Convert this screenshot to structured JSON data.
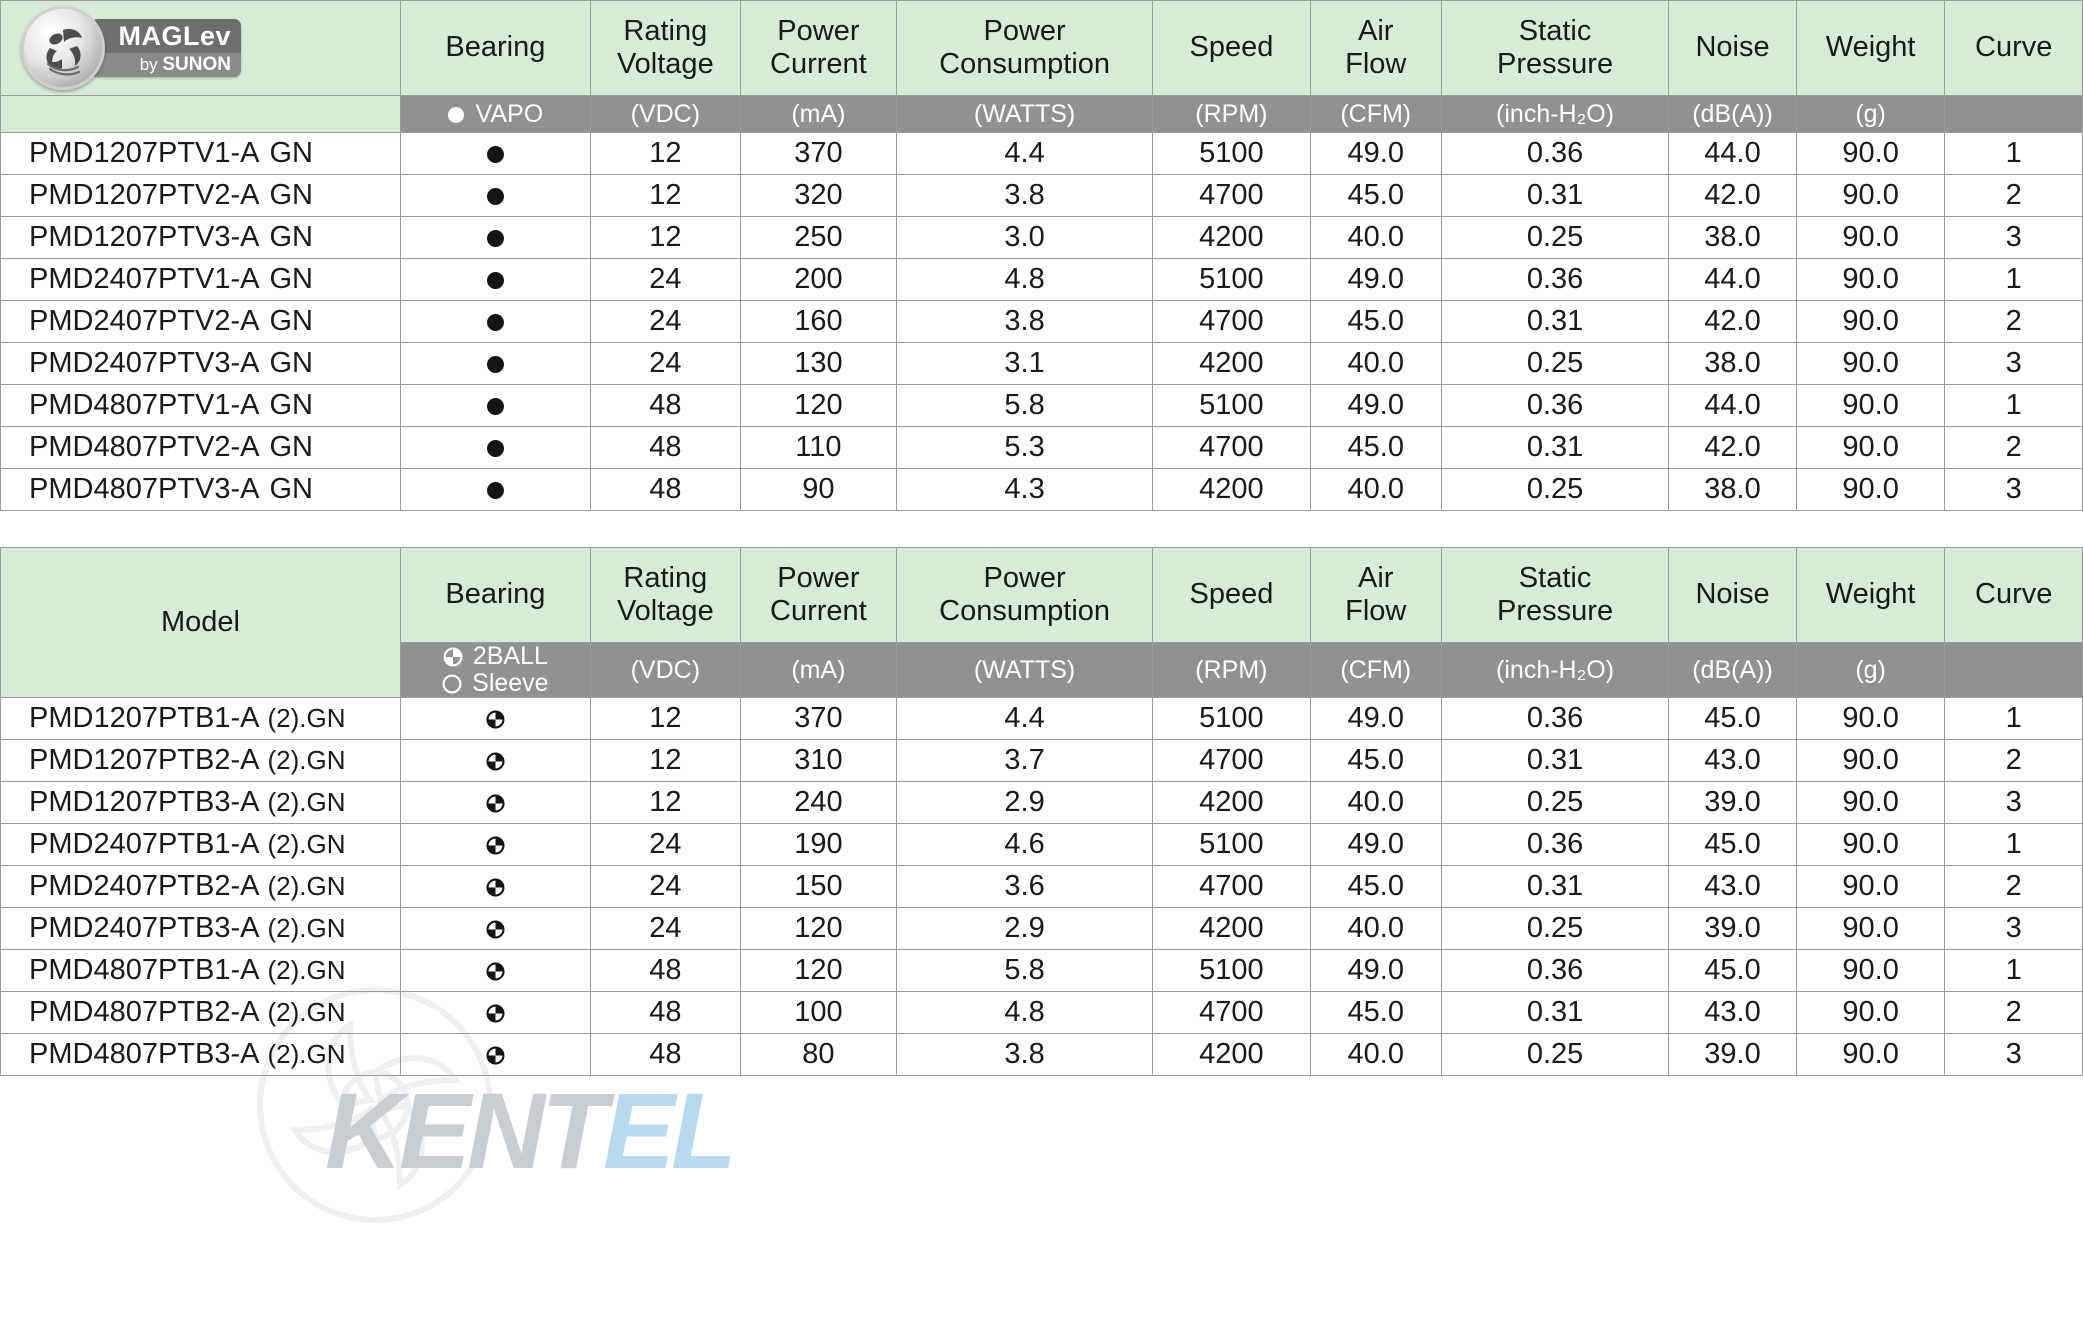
{
  "logo": {
    "brand": "MAGLev",
    "byline_prefix": "by ",
    "byline_brand": "SUNON",
    "icon": "maglev-fan-logo"
  },
  "watermark": {
    "text_part1": "KENT",
    "text_part2": "EL",
    "icon": "fan-blade-icon"
  },
  "columns": {
    "model": "Model",
    "bearing": "Bearing",
    "rating_voltage_l1": "Rating",
    "rating_voltage_l2": "Voltage",
    "power_current_l1": "Power",
    "power_current_l2": "Current",
    "power_consumption_l1": "Power",
    "power_consumption_l2": "Consumption",
    "speed": "Speed",
    "air_flow_l1": "Air",
    "air_flow_l2": "Flow",
    "static_pressure_l1": "Static",
    "static_pressure_l2": "Pressure",
    "noise": "Noise",
    "weight": "Weight",
    "curve": "Curve"
  },
  "units": {
    "bearing_vapo": "VAPO",
    "bearing_2ball": "2BALL",
    "bearing_sleeve": "Sleeve",
    "rating_voltage": "(VDC)",
    "power_current": "(mA)",
    "power_consumption": "(WATTS)",
    "speed": "(RPM)",
    "air_flow": "(CFM)",
    "static_pressure": "(inch-H₂O)",
    "noise": "(dB(A))",
    "weight": "(g)",
    "curve": ""
  },
  "table1": {
    "bearing_type": "vapo",
    "rows": [
      {
        "model": "PMD1207PTV1-A",
        "suffix": "GN",
        "voltage": "12",
        "current": "370",
        "consumption": "4.4",
        "speed": "5100",
        "airflow": "49.0",
        "pressure": "0.36",
        "noise": "44.0",
        "weight": "90.0",
        "curve": "1"
      },
      {
        "model": "PMD1207PTV2-A",
        "suffix": "GN",
        "voltage": "12",
        "current": "320",
        "consumption": "3.8",
        "speed": "4700",
        "airflow": "45.0",
        "pressure": "0.31",
        "noise": "42.0",
        "weight": "90.0",
        "curve": "2"
      },
      {
        "model": "PMD1207PTV3-A",
        "suffix": "GN",
        "voltage": "12",
        "current": "250",
        "consumption": "3.0",
        "speed": "4200",
        "airflow": "40.0",
        "pressure": "0.25",
        "noise": "38.0",
        "weight": "90.0",
        "curve": "3"
      },
      {
        "model": "PMD2407PTV1-A",
        "suffix": "GN",
        "voltage": "24",
        "current": "200",
        "consumption": "4.8",
        "speed": "5100",
        "airflow": "49.0",
        "pressure": "0.36",
        "noise": "44.0",
        "weight": "90.0",
        "curve": "1"
      },
      {
        "model": "PMD2407PTV2-A",
        "suffix": "GN",
        "voltage": "24",
        "current": "160",
        "consumption": "3.8",
        "speed": "4700",
        "airflow": "45.0",
        "pressure": "0.31",
        "noise": "42.0",
        "weight": "90.0",
        "curve": "2"
      },
      {
        "model": "PMD2407PTV3-A",
        "suffix": "GN",
        "voltage": "24",
        "current": "130",
        "consumption": "3.1",
        "speed": "4200",
        "airflow": "40.0",
        "pressure": "0.25",
        "noise": "38.0",
        "weight": "90.0",
        "curve": "3"
      },
      {
        "model": "PMD4807PTV1-A",
        "suffix": "GN",
        "voltage": "48",
        "current": "120",
        "consumption": "5.8",
        "speed": "5100",
        "airflow": "49.0",
        "pressure": "0.36",
        "noise": "44.0",
        "weight": "90.0",
        "curve": "1"
      },
      {
        "model": "PMD4807PTV2-A",
        "suffix": "GN",
        "voltage": "48",
        "current": "110",
        "consumption": "5.3",
        "speed": "4700",
        "airflow": "45.0",
        "pressure": "0.31",
        "noise": "42.0",
        "weight": "90.0",
        "curve": "2"
      },
      {
        "model": "PMD4807PTV3-A",
        "suffix": "GN",
        "voltage": "48",
        "current": "90",
        "consumption": "4.3",
        "speed": "4200",
        "airflow": "40.0",
        "pressure": "0.25",
        "noise": "38.0",
        "weight": "90.0",
        "curve": "3"
      }
    ]
  },
  "table2": {
    "bearing_type": "2ball",
    "rows": [
      {
        "model": "PMD1207PTB1-A",
        "suffix": "(2).GN",
        "voltage": "12",
        "current": "370",
        "consumption": "4.4",
        "speed": "5100",
        "airflow": "49.0",
        "pressure": "0.36",
        "noise": "45.0",
        "weight": "90.0",
        "curve": "1"
      },
      {
        "model": "PMD1207PTB2-A",
        "suffix": "(2).GN",
        "voltage": "12",
        "current": "310",
        "consumption": "3.7",
        "speed": "4700",
        "airflow": "45.0",
        "pressure": "0.31",
        "noise": "43.0",
        "weight": "90.0",
        "curve": "2"
      },
      {
        "model": "PMD1207PTB3-A",
        "suffix": "(2).GN",
        "voltage": "12",
        "current": "240",
        "consumption": "2.9",
        "speed": "4200",
        "airflow": "40.0",
        "pressure": "0.25",
        "noise": "39.0",
        "weight": "90.0",
        "curve": "3"
      },
      {
        "model": "PMD2407PTB1-A",
        "suffix": "(2).GN",
        "voltage": "24",
        "current": "190",
        "consumption": "4.6",
        "speed": "5100",
        "airflow": "49.0",
        "pressure": "0.36",
        "noise": "45.0",
        "weight": "90.0",
        "curve": "1"
      },
      {
        "model": "PMD2407PTB2-A",
        "suffix": "(2).GN",
        "voltage": "24",
        "current": "150",
        "consumption": "3.6",
        "speed": "4700",
        "airflow": "45.0",
        "pressure": "0.31",
        "noise": "43.0",
        "weight": "90.0",
        "curve": "2"
      },
      {
        "model": "PMD2407PTB3-A",
        "suffix": "(2).GN",
        "voltage": "24",
        "current": "120",
        "consumption": "2.9",
        "speed": "4200",
        "airflow": "40.0",
        "pressure": "0.25",
        "noise": "39.0",
        "weight": "90.0",
        "curve": "3"
      },
      {
        "model": "PMD4807PTB1-A",
        "suffix": "(2).GN",
        "voltage": "48",
        "current": "120",
        "consumption": "5.8",
        "speed": "5100",
        "airflow": "49.0",
        "pressure": "0.36",
        "noise": "45.0",
        "weight": "90.0",
        "curve": "1"
      },
      {
        "model": "PMD4807PTB2-A",
        "suffix": "(2).GN",
        "voltage": "48",
        "current": "100",
        "consumption": "4.8",
        "speed": "4700",
        "airflow": "45.0",
        "pressure": "0.31",
        "noise": "43.0",
        "weight": "90.0",
        "curve": "2"
      },
      {
        "model": "PMD4807PTB3-A",
        "suffix": "(2).GN",
        "voltage": "48",
        "current": "80",
        "consumption": "3.8",
        "speed": "4200",
        "airflow": "40.0",
        "pressure": "0.25",
        "noise": "39.0",
        "weight": "90.0",
        "curve": "3"
      }
    ]
  },
  "colors": {
    "header_green": "#d8ead8",
    "unit_gray": "#8f9193",
    "border": "#9b9b9b",
    "text": "#1a1a1a"
  }
}
